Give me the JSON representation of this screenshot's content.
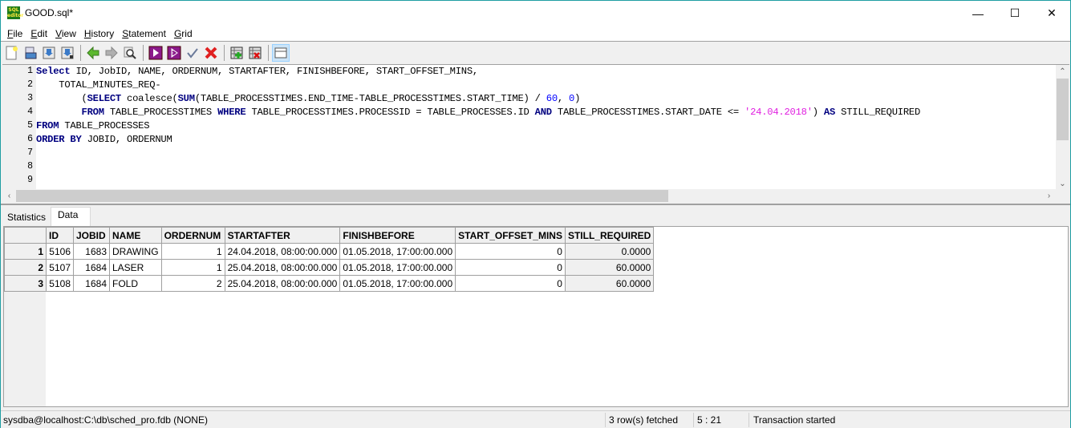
{
  "window": {
    "title": "GOOD.sql*",
    "app_icon_text": "SQL editor",
    "controls": {
      "minimize": "—",
      "maximize": "☐",
      "close": "✕"
    }
  },
  "menu": [
    {
      "label": "File",
      "mnemonic": "F",
      "rest": "ile"
    },
    {
      "label": "Edit",
      "mnemonic": "E",
      "rest": "dit"
    },
    {
      "label": "View",
      "mnemonic": "V",
      "rest": "iew"
    },
    {
      "label": "History",
      "mnemonic": "H",
      "rest": "istory"
    },
    {
      "label": "Statement",
      "mnemonic": "S",
      "rest": "tatement"
    },
    {
      "label": "Grid",
      "mnemonic": "G",
      "rest": "rid"
    }
  ],
  "toolbar": {
    "buttons": [
      "new-file",
      "open-file",
      "save-file",
      "save-as",
      "history-back",
      "history-forward",
      "find",
      "execute",
      "execute-step",
      "commit",
      "rollback",
      "grid-add-row",
      "grid-delete-row",
      "toggle-layout"
    ]
  },
  "editor": {
    "line_numbers": [
      "1",
      "2",
      "3",
      "4",
      "5",
      "6",
      "7",
      "8",
      "9"
    ],
    "lines": [
      [
        {
          "t": "Select",
          "c": "kw"
        },
        {
          "t": " ID, JobID, NAME, ORDERNUM, STARTAFTER, FINISHBEFORE, START_OFFSET_MINS,",
          "c": ""
        }
      ],
      [
        {
          "t": "    TOTAL_MINUTES_REQ-",
          "c": ""
        }
      ],
      [
        {
          "t": "        (",
          "c": ""
        },
        {
          "t": "SELECT",
          "c": "kw"
        },
        {
          "t": " coalesce(",
          "c": ""
        },
        {
          "t": "SUM",
          "c": "kw"
        },
        {
          "t": "(TABLE_PROCESSTIMES.END_TIME-TABLE_PROCESSTIMES.START_TIME) / ",
          "c": ""
        },
        {
          "t": "60",
          "c": "num"
        },
        {
          "t": ", ",
          "c": ""
        },
        {
          "t": "0",
          "c": "num"
        },
        {
          "t": ")",
          "c": ""
        }
      ],
      [
        {
          "t": "        ",
          "c": ""
        },
        {
          "t": "FROM",
          "c": "kw"
        },
        {
          "t": " TABLE_PROCESSTIMES ",
          "c": ""
        },
        {
          "t": "WHERE",
          "c": "kw"
        },
        {
          "t": " TABLE_PROCESSTIMES.PROCESSID = TABLE_PROCESSES.ID ",
          "c": ""
        },
        {
          "t": "AND",
          "c": "kw"
        },
        {
          "t": " TABLE_PROCESSTIMES.START_DATE <= ",
          "c": ""
        },
        {
          "t": "'24.04.2018'",
          "c": "str"
        },
        {
          "t": ") ",
          "c": ""
        },
        {
          "t": "AS",
          "c": "kw"
        },
        {
          "t": " STILL_REQUIRED",
          "c": ""
        }
      ],
      [
        {
          "t": "FROM",
          "c": "kw"
        },
        {
          "t": " TABLE_PROCESSES",
          "c": ""
        }
      ],
      [
        {
          "t": "ORDER BY",
          "c": "kw"
        },
        {
          "t": " JOBID, ORDERNUM",
          "c": ""
        }
      ],
      [],
      [],
      []
    ]
  },
  "tabs": [
    {
      "label": "Statistics",
      "selected": false
    },
    {
      "label": "Data",
      "selected": true
    }
  ],
  "grid": {
    "columns": [
      "ID",
      "JOBID",
      "NAME",
      "ORDERNUM",
      "STARTAFTER",
      "FINISHBEFORE",
      "START_OFFSET_MINS",
      "STILL_REQUIRED"
    ],
    "rows": [
      {
        "n": "1",
        "cells": [
          "5106",
          "1683",
          "DRAWING",
          "1",
          "24.04.2018, 08:00:00.000",
          "01.05.2018, 17:00:00.000",
          "0",
          "0.0000"
        ]
      },
      {
        "n": "2",
        "cells": [
          "5107",
          "1684",
          "LASER",
          "1",
          "25.04.2018, 08:00:00.000",
          "01.05.2018, 17:00:00.000",
          "0",
          "60.0000"
        ]
      },
      {
        "n": "3",
        "cells": [
          "5108",
          "1684",
          "FOLD",
          "2",
          "25.04.2018, 08:00:00.000",
          "01.05.2018, 17:00:00.000",
          "0",
          "60.0000"
        ]
      }
    ]
  },
  "status": {
    "connection": "sysdba@localhost:C:\\db\\sched_pro.fdb (NONE)",
    "rows_fetched": "3 row(s) fetched",
    "cursor": "5 : 21",
    "transaction": "Transaction started"
  }
}
